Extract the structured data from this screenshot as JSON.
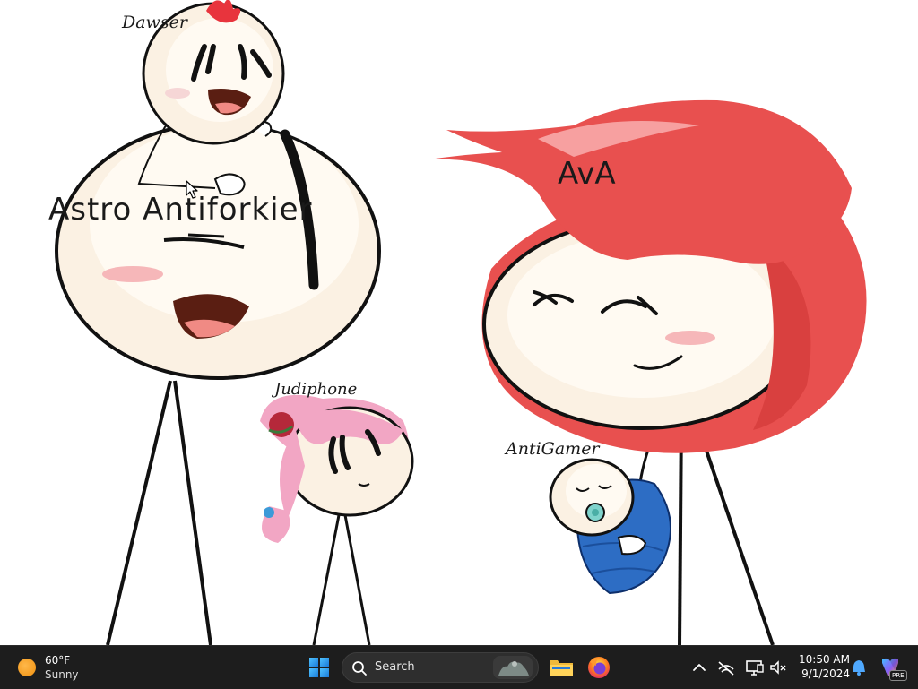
{
  "wallpaper": {
    "labels": {
      "dawser": "Dawser",
      "astro": "Astro Antiforkier",
      "ava": "AvA",
      "judiphone": "Judiphone",
      "antigamer": "AntiGamer"
    },
    "colors": {
      "skin": "#fbf1e3",
      "blush": "#f6b7b9",
      "ava_hair": "#e8504f",
      "ava_hair_highlight": "#f7a0a0",
      "judiphone_hair": "#f2a6c4",
      "dawser_hair": "#e8343d",
      "blanket": "#2d6dc4",
      "mouth": "#5a1e12",
      "mouth_inner": "#f08a84"
    }
  },
  "taskbar": {
    "weather": {
      "temperature": "60°F",
      "condition": "Sunny",
      "icon": "sun-icon"
    },
    "search": {
      "placeholder": "Search"
    },
    "apps": [
      "start-windows-icon",
      "file-explorer-icon",
      "firefox-icon"
    ],
    "tray": [
      "chevron-up-icon",
      "network-off-icon",
      "display-icon",
      "volume-mute-icon"
    ],
    "clock": {
      "time": "10:50 AM",
      "date": "9/1/2024"
    },
    "notification_icon": "bell-icon",
    "copilot_icon": "copilot-icon",
    "copilot_badge": "PRE"
  }
}
